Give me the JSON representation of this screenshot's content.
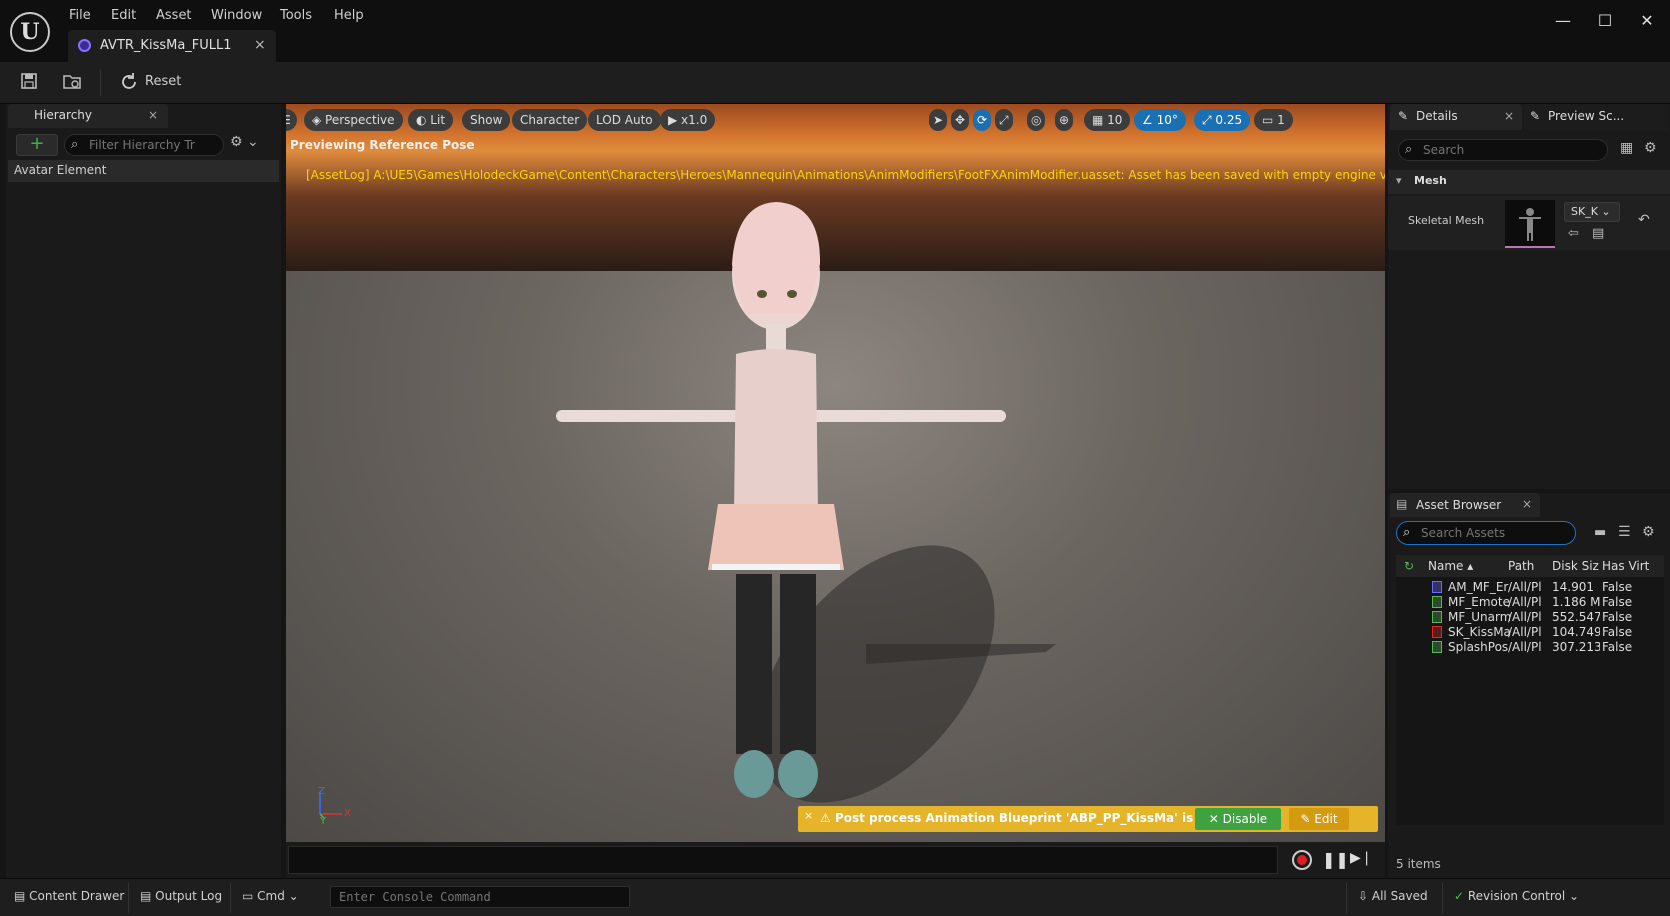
{
  "menu": [
    "File",
    "Edit",
    "Asset",
    "Window",
    "Tools",
    "Help"
  ],
  "document_tab": {
    "title": "AVTR_KissMa_FULL1",
    "close": "×"
  },
  "window_controls": {
    "minimize": "—",
    "maximize": "☐",
    "close": "✕"
  },
  "toolbar": {
    "reset_label": "Reset"
  },
  "hierarchy": {
    "tab_label": "Hierarchy",
    "close": "×",
    "add": "+",
    "filter_placeholder": "Filter Hierarchy Tr",
    "items": [
      "Avatar Element"
    ]
  },
  "viewport": {
    "buttons": {
      "perspective": "Perspective",
      "lit": "Lit",
      "show": "Show",
      "character": "Character",
      "lod": "LOD Auto",
      "speed": "x1.0",
      "grid_snap": "10",
      "rotation_snap": "10°",
      "scale_snap": "0.25",
      "camera_speed": "1"
    },
    "label": "Previewing Reference Pose",
    "log": "[AssetLog] A:\\UE5\\Games\\HolodeckGame\\Content\\Characters\\Heroes\\Mannequin\\Animations\\AnimModifiers\\FootFXAnimModifier.uasset: Asset has been saved with empty engine versio",
    "axes": {
      "z": "Z",
      "x": "X",
      "y": "Y"
    },
    "notification": {
      "text": "Post process Animation Blueprint 'ABP_PP_KissMa' is running.",
      "disable": "Disable",
      "edit": "Edit",
      "close": "×"
    }
  },
  "details": {
    "tab_label": "Details",
    "tab2_label": "Preview Sc...",
    "close": "×",
    "search_placeholder": "Search",
    "section": "Mesh",
    "property_label": "Skeletal Mesh",
    "property_value": "SK_K"
  },
  "asset_browser": {
    "tab_label": "Asset Browser",
    "close": "×",
    "search_placeholder": "Search Assets",
    "columns": [
      "Name",
      "Path",
      "Disk Siz",
      "Has Virt"
    ],
    "rows": [
      {
        "name": "AM_MF_Er",
        "path": "/All/Pl",
        "size": "14.901",
        "virt": "False",
        "color": "#6b6bff"
      },
      {
        "name": "MF_Emote",
        "path": "/All/Pl",
        "size": "1.186 M",
        "virt": "False",
        "color": "#58b858"
      },
      {
        "name": "MF_Unarm",
        "path": "/All/Pl",
        "size": "552.547",
        "virt": "False",
        "color": "#58b858"
      },
      {
        "name": "SK_KissMa",
        "path": "/All/Pl",
        "size": "104.749",
        "virt": "False",
        "color": "#e02a2a"
      },
      {
        "name": "SplashPos",
        "path": "/All/Pl",
        "size": "307.213",
        "virt": "False",
        "color": "#58b858"
      }
    ],
    "count": "5 items"
  },
  "statusbar": {
    "content_drawer": "Content Drawer",
    "output_log": "Output Log",
    "cmd": "Cmd",
    "console_placeholder": "Enter Console Command",
    "all_saved": "All Saved",
    "revision_control": "Revision Control"
  }
}
